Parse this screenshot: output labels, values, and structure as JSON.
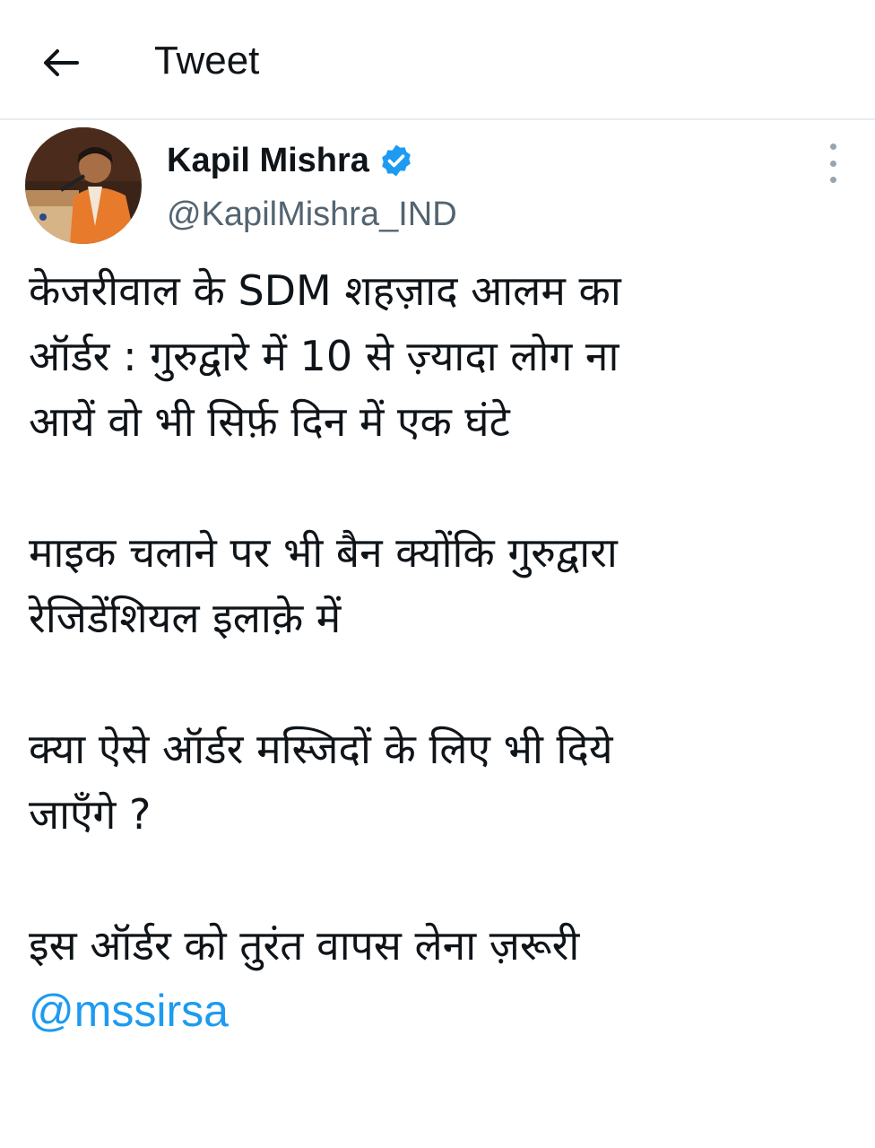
{
  "header": {
    "back_icon": "arrow-left-icon",
    "title": "Tweet"
  },
  "author": {
    "name": "Kapil Mishra",
    "handle": "@KapilMishra_IND",
    "verified_icon": "verified-badge-icon",
    "verified_color": "#1d9bf0"
  },
  "more_icon": "more-vertical-icon",
  "tweet": {
    "lines_p1": [
      "केजरीवाल के SDM शहज़ाद आलम का",
      "ऑर्डर : गुरुद्वारे में 10 से ज़्यादा लोग ना",
      "आयें वो भी सिर्फ़ दिन में एक घंटे"
    ],
    "lines_p2": [
      "माइक चलाने पर भी बैन क्योंकि गुरुद्वारा",
      "रेजिडेंशियल इलाक़े में"
    ],
    "lines_p3": [
      "क्या ऐसे ऑर्डर मस्जिदों के लिए भी दिये",
      "जाएँगे ?"
    ],
    "lines_p4": [
      "इस ऑर्डर को तुरंत वापस लेना ज़रूरी"
    ],
    "mention": "@mssirsa",
    "mention_color": "#1d9bf0"
  }
}
